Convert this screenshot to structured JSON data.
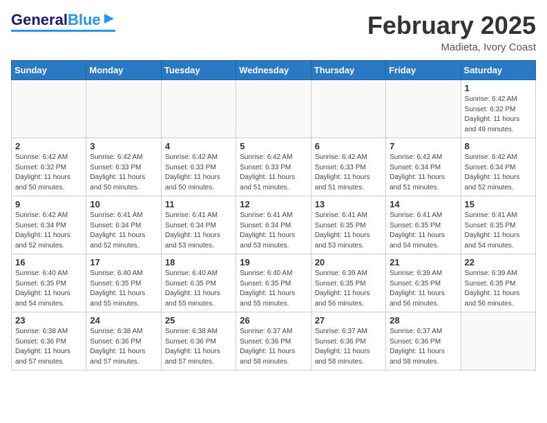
{
  "header": {
    "logo_general": "General",
    "logo_blue": "Blue",
    "month_title": "February 2025",
    "location": "Madieta, Ivory Coast"
  },
  "weekdays": [
    "Sunday",
    "Monday",
    "Tuesday",
    "Wednesday",
    "Thursday",
    "Friday",
    "Saturday"
  ],
  "weeks": [
    [
      {
        "day": "",
        "info": ""
      },
      {
        "day": "",
        "info": ""
      },
      {
        "day": "",
        "info": ""
      },
      {
        "day": "",
        "info": ""
      },
      {
        "day": "",
        "info": ""
      },
      {
        "day": "",
        "info": ""
      },
      {
        "day": "1",
        "info": "Sunrise: 6:42 AM\nSunset: 6:32 PM\nDaylight: 11 hours\nand 49 minutes."
      }
    ],
    [
      {
        "day": "2",
        "info": "Sunrise: 6:42 AM\nSunset: 6:32 PM\nDaylight: 11 hours\nand 50 minutes."
      },
      {
        "day": "3",
        "info": "Sunrise: 6:42 AM\nSunset: 6:33 PM\nDaylight: 11 hours\nand 50 minutes."
      },
      {
        "day": "4",
        "info": "Sunrise: 6:42 AM\nSunset: 6:33 PM\nDaylight: 11 hours\nand 50 minutes."
      },
      {
        "day": "5",
        "info": "Sunrise: 6:42 AM\nSunset: 6:33 PM\nDaylight: 11 hours\nand 51 minutes."
      },
      {
        "day": "6",
        "info": "Sunrise: 6:42 AM\nSunset: 6:33 PM\nDaylight: 11 hours\nand 51 minutes."
      },
      {
        "day": "7",
        "info": "Sunrise: 6:42 AM\nSunset: 6:34 PM\nDaylight: 11 hours\nand 51 minutes."
      },
      {
        "day": "8",
        "info": "Sunrise: 6:42 AM\nSunset: 6:34 PM\nDaylight: 11 hours\nand 52 minutes."
      }
    ],
    [
      {
        "day": "9",
        "info": "Sunrise: 6:42 AM\nSunset: 6:34 PM\nDaylight: 11 hours\nand 52 minutes."
      },
      {
        "day": "10",
        "info": "Sunrise: 6:41 AM\nSunset: 6:34 PM\nDaylight: 11 hours\nand 52 minutes."
      },
      {
        "day": "11",
        "info": "Sunrise: 6:41 AM\nSunset: 6:34 PM\nDaylight: 11 hours\nand 53 minutes."
      },
      {
        "day": "12",
        "info": "Sunrise: 6:41 AM\nSunset: 6:34 PM\nDaylight: 11 hours\nand 53 minutes."
      },
      {
        "day": "13",
        "info": "Sunrise: 6:41 AM\nSunset: 6:35 PM\nDaylight: 11 hours\nand 53 minutes."
      },
      {
        "day": "14",
        "info": "Sunrise: 6:41 AM\nSunset: 6:35 PM\nDaylight: 11 hours\nand 54 minutes."
      },
      {
        "day": "15",
        "info": "Sunrise: 6:41 AM\nSunset: 6:35 PM\nDaylight: 11 hours\nand 54 minutes."
      }
    ],
    [
      {
        "day": "16",
        "info": "Sunrise: 6:40 AM\nSunset: 6:35 PM\nDaylight: 11 hours\nand 54 minutes."
      },
      {
        "day": "17",
        "info": "Sunrise: 6:40 AM\nSunset: 6:35 PM\nDaylight: 11 hours\nand 55 minutes."
      },
      {
        "day": "18",
        "info": "Sunrise: 6:40 AM\nSunset: 6:35 PM\nDaylight: 11 hours\nand 55 minutes."
      },
      {
        "day": "19",
        "info": "Sunrise: 6:40 AM\nSunset: 6:35 PM\nDaylight: 11 hours\nand 55 minutes."
      },
      {
        "day": "20",
        "info": "Sunrise: 6:39 AM\nSunset: 6:35 PM\nDaylight: 11 hours\nand 56 minutes."
      },
      {
        "day": "21",
        "info": "Sunrise: 6:39 AM\nSunset: 6:35 PM\nDaylight: 11 hours\nand 56 minutes."
      },
      {
        "day": "22",
        "info": "Sunrise: 6:39 AM\nSunset: 6:35 PM\nDaylight: 11 hours\nand 56 minutes."
      }
    ],
    [
      {
        "day": "23",
        "info": "Sunrise: 6:38 AM\nSunset: 6:36 PM\nDaylight: 11 hours\nand 57 minutes."
      },
      {
        "day": "24",
        "info": "Sunrise: 6:38 AM\nSunset: 6:36 PM\nDaylight: 11 hours\nand 57 minutes."
      },
      {
        "day": "25",
        "info": "Sunrise: 6:38 AM\nSunset: 6:36 PM\nDaylight: 11 hours\nand 57 minutes."
      },
      {
        "day": "26",
        "info": "Sunrise: 6:37 AM\nSunset: 6:36 PM\nDaylight: 11 hours\nand 58 minutes."
      },
      {
        "day": "27",
        "info": "Sunrise: 6:37 AM\nSunset: 6:36 PM\nDaylight: 11 hours\nand 58 minutes."
      },
      {
        "day": "28",
        "info": "Sunrise: 6:37 AM\nSunset: 6:36 PM\nDaylight: 11 hours\nand 58 minutes."
      },
      {
        "day": "",
        "info": ""
      }
    ]
  ]
}
